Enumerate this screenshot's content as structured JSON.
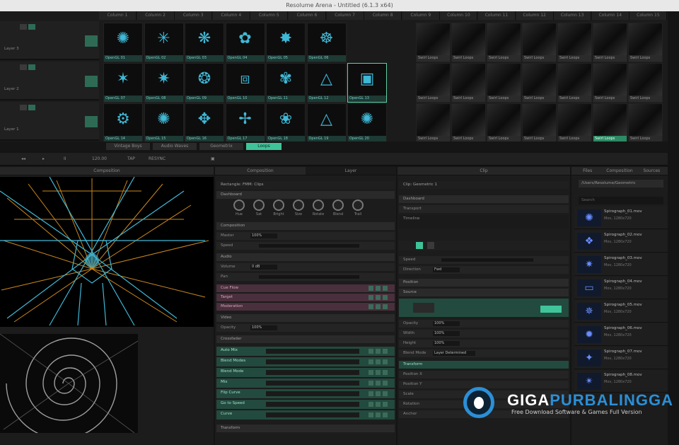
{
  "window": {
    "title": "Resolume Arena - Untitled (6.1.3 x64)"
  },
  "deck": {
    "columns": [
      "Column 1",
      "Column 2",
      "Column 3",
      "Column 4",
      "Column 5",
      "Column 6",
      "Column 7",
      "Column 8",
      "Column 9",
      "Column 10",
      "Column 11",
      "Column 12",
      "Column 13",
      "Column 14",
      "Column 15"
    ],
    "layers": [
      {
        "label": "Layer 3",
        "clips": [
          "OpenGL 01",
          "OpenGL 02",
          "OpenGL 03",
          "OpenGL 04",
          "OpenGL 05",
          "OpenGL 06"
        ],
        "glyphs": [
          "✺",
          "✳",
          "❋",
          "✿",
          "✸",
          "☸"
        ]
      },
      {
        "label": "Layer 2",
        "clips": [
          "OpenGL 07",
          "OpenGL 08",
          "OpenGL 09",
          "OpenGL 10",
          "OpenGL 11",
          "OpenGL 12",
          "OpenGL 13"
        ],
        "glyphs": [
          "✶",
          "✷",
          "❂",
          "⧈",
          "✾",
          "△",
          "▣"
        ]
      },
      {
        "label": "Layer 1",
        "clips": [
          "OpenGL 14",
          "OpenGL 15",
          "OpenGL 16",
          "OpenGL 17",
          "OpenGL 18",
          "OpenGL 19",
          "OpenGL 20"
        ],
        "glyphs": [
          "⚙",
          "✺",
          "✥",
          "✢",
          "❀",
          "△",
          "✺"
        ]
      }
    ],
    "bwclips": [
      "Swirl Loops",
      "Swirl Loops",
      "Swirl Loops",
      "Swirl Loops",
      "Swirl Loops",
      "Swirl Loops",
      "Swirl Loops"
    ],
    "tabs": [
      "Vintage Boys",
      "Audio Waves",
      "Geometrix",
      "Loops"
    ]
  },
  "toolbar": {
    "bpm": "120.00",
    "tap": "TAP",
    "resync": "RESYNC",
    "pause": "II"
  },
  "panels": {
    "composition": {
      "title": "Composition"
    },
    "layer": {
      "title": "Layer"
    },
    "clip": {
      "title": "Clip"
    },
    "files": {
      "tabs": [
        "Files",
        "Composition",
        "Sources"
      ]
    }
  },
  "effect": {
    "title": "Rectangle: FMM: Clips",
    "sections": {
      "dashboard": "Dashboard",
      "composition": "Composition",
      "audio": "Audio",
      "video": "Video",
      "crossfader": "Crossfader",
      "transform": "Transform"
    },
    "knobs": [
      "Hue",
      "Sat",
      "Bright",
      "Size",
      "Rotate",
      "Blend",
      "Trail"
    ],
    "rows": {
      "master": "Master",
      "master_val": "100%",
      "speed": "Speed",
      "volume": "Volume",
      "volume_val": "0 dB",
      "pan": "Pan",
      "pink": [
        "Cue Flow",
        "Target",
        "Moderation"
      ],
      "opacity": "Opacity",
      "opacity_val": "100%",
      "green": [
        "Auto Mix",
        "Blend Modes",
        "Blend Mode",
        "Mix",
        "Flip Curve",
        "Go to Speed",
        "Curve"
      ]
    }
  },
  "clip": {
    "title": "Clip: Geometric 1",
    "rows": {
      "dashboard": "Dashboard",
      "transport": "Transport",
      "timeline": "Timeline",
      "speed": "Speed",
      "direction": "Direction",
      "dir_val": "Fwd",
      "position": "Position",
      "source": "Source",
      "opacity": "Opacity",
      "opacity_val": "100%",
      "width": "Width",
      "width_val": "100%",
      "height": "Height",
      "height_val": "100%",
      "blend": "Blend Mode",
      "blend_val": "Layer Determined",
      "transform": "Transform",
      "pos_x": "Position X",
      "pos_y": "Position Y",
      "scale": "Scale",
      "rotation": "Rotation",
      "anchor": "Anchor"
    }
  },
  "files": {
    "search": "Search",
    "path": "/Users/Resolume/Geometric",
    "items": [
      {
        "name": "Spirograph_01.mov",
        "sub": "Mov, 1280x720",
        "glyph": "✺"
      },
      {
        "name": "Spirograph_02.mov",
        "sub": "Mov, 1280x720",
        "glyph": "❖"
      },
      {
        "name": "Spirograph_03.mov",
        "sub": "Mov, 1280x720",
        "glyph": "✷"
      },
      {
        "name": "Spirograph_04.mov",
        "sub": "Mov, 1280x720",
        "glyph": "▭"
      },
      {
        "name": "Spirograph_05.mov",
        "sub": "Mov, 1280x720",
        "glyph": "✵"
      },
      {
        "name": "Spirograph_06.mov",
        "sub": "Mov, 1280x720",
        "glyph": "✹"
      },
      {
        "name": "Spirograph_07.mov",
        "sub": "Mov, 1280x720",
        "glyph": "✦"
      },
      {
        "name": "Spirograph_08.mov",
        "sub": "Mov, 1280x720",
        "glyph": "✴"
      }
    ]
  },
  "watermark": {
    "brand_a": "GIGA",
    "brand_b": "PURBALINGGA",
    "tagline": "Free Download Software & Games Full Version"
  },
  "colors": {
    "accent": "#3fc49a",
    "cyan": "#3fb8d6",
    "orange": "#f0a020"
  }
}
